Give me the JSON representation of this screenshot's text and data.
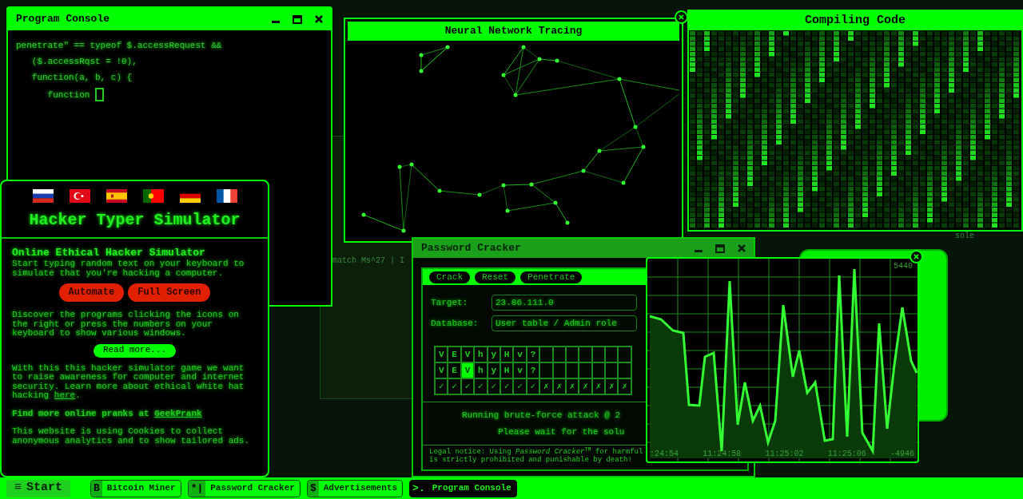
{
  "desktop_fragments": [
    {
      "text": "match Ms^27 | I"
    },
    {
      "text": "sole"
    }
  ],
  "program_console": {
    "title": "Program Console",
    "lines": [
      "penetrate\" == typeof $.accessRequest &&",
      "   ($.accessRqst = !0),",
      "   function(a, b, c) {",
      "      function"
    ]
  },
  "neural_network": {
    "title": "Neural Network Tracing"
  },
  "compiling_code": {
    "title": "Compiling Code"
  },
  "hacker_panel": {
    "title": "Hacker Typer Simulator",
    "heading": "Online Ethical Hacker Simulator",
    "intro": "Start typing random text on your keyboard to simulate that you're hacking a computer.",
    "buttons": [
      "Automate",
      "Full Screen"
    ],
    "discover": "Discover the programs clicking the icons on the right or press the numbers on your keyboard to show various windows.",
    "read_more": "Read more...",
    "awareness": {
      "text": "With this this hacker simulator game we want to raise awareness for computer and internet security. Learn more about ethical white hat hacking ",
      "link": "here",
      "after": "."
    },
    "pranks": {
      "text": "Find more online pranks at ",
      "link": "GeekPrank"
    },
    "cookies": "This website is using Cookies to collect anonymous analytics and to show tailored ads."
  },
  "password_cracker": {
    "title": "Password Cracker",
    "actions": [
      "Crack",
      "Reset",
      "Penetrate"
    ],
    "fields": [
      {
        "label": "Target:",
        "value": "23.86.111.0"
      },
      {
        "label": "Database:",
        "value": "User table / Admin role"
      }
    ],
    "grid": [
      [
        {
          "text": "V",
          "selected": false
        },
        {
          "text": "E",
          "selected": false
        },
        {
          "text": "V",
          "selected": false
        },
        {
          "text": "h",
          "selected": false
        },
        {
          "text": "y",
          "selected": false
        },
        {
          "text": "H",
          "selected": false
        },
        {
          "text": "v",
          "selected": false
        },
        {
          "text": "?",
          "selected": false
        },
        {
          "selected": false
        },
        {
          "selected": false
        },
        {
          "selected": false
        },
        {
          "selected": false
        },
        {
          "selected": false
        },
        {
          "selected": false
        },
        {
          "selected": false
        }
      ],
      [
        {
          "text": "V",
          "selected": false
        },
        {
          "text": "E",
          "selected": false
        },
        {
          "text": "V",
          "selected": true
        },
        {
          "text": "h",
          "selected": false
        },
        {
          "text": "y",
          "selected": false
        },
        {
          "text": "H",
          "selected": false
        },
        {
          "text": "v",
          "selected": false
        },
        {
          "text": "?",
          "selected": false
        },
        {
          "selected": false
        },
        {
          "selected": false
        },
        {
          "selected": false
        },
        {
          "selected": false
        },
        {
          "selected": false
        },
        {
          "selected": false
        },
        {
          "selected": false
        }
      ],
      [
        {
          "text": "✓",
          "selected": false
        },
        {
          "text": "✓",
          "selected": false
        },
        {
          "text": "✓",
          "selected": false
        },
        {
          "text": "✓",
          "selected": false
        },
        {
          "text": "✓",
          "selected": false
        },
        {
          "text": "✓",
          "selected": false
        },
        {
          "text": "✓",
          "selected": false
        },
        {
          "text": "✓",
          "selected": false
        },
        {
          "text": "✗",
          "selected": false
        },
        {
          "text": "✗",
          "selected": false
        },
        {
          "text": "✗",
          "selected": false
        },
        {
          "text": "✗",
          "selected": false
        },
        {
          "text": "✗",
          "selected": false
        },
        {
          "text": "✗",
          "selected": false
        },
        {
          "text": "✗",
          "selected": false
        }
      ]
    ],
    "status": [
      "Running brute-force attack @ 2",
      "Please wait for the solu"
    ],
    "legal": [
      "Legal notice: Using *Password Cracker*$^{TM}$ for harmful",
      "is strictly prohibited and punishable by death!"
    ]
  },
  "graph": {
    "max_label": "5440",
    "time_labels": [
      ":24:54",
      "11:24:58",
      "11:25:02",
      "11:25:06"
    ],
    "min_label": "-4946"
  },
  "taskbar": {
    "start": {
      "icon": "≡",
      "label": "Start"
    },
    "items": [
      {
        "icon": "B",
        "label": "Bitcoin Miner",
        "selected": false
      },
      {
        "icon": "*|",
        "label": "Password Cracker",
        "selected": false
      },
      {
        "icon": "$",
        "label": "Advertisements",
        "selected": false
      },
      {
        "icon": ">.",
        "label": "Program Console",
        "selected": true
      }
    ]
  }
}
